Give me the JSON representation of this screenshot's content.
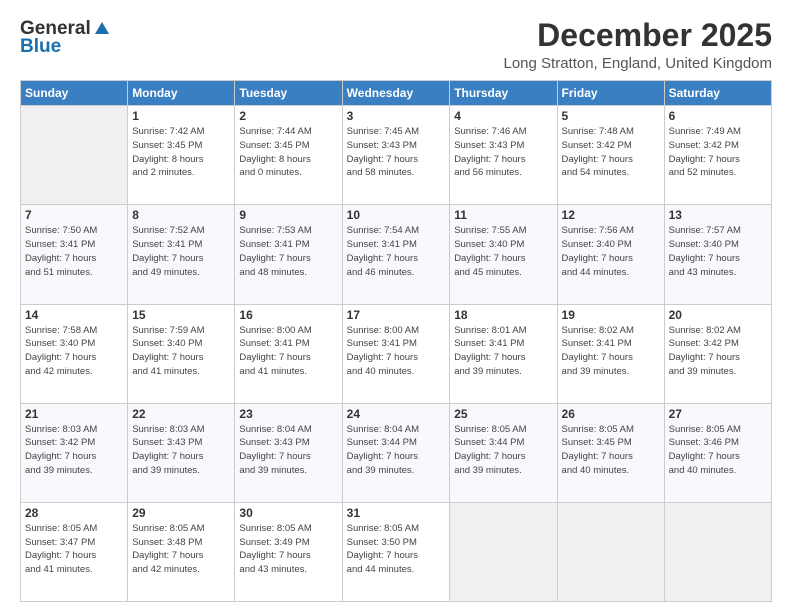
{
  "logo": {
    "general": "General",
    "blue": "Blue"
  },
  "header": {
    "month": "December 2025",
    "location": "Long Stratton, England, United Kingdom"
  },
  "weekdays": [
    "Sunday",
    "Monday",
    "Tuesday",
    "Wednesday",
    "Thursday",
    "Friday",
    "Saturday"
  ],
  "weeks": [
    [
      {
        "day": "",
        "info": ""
      },
      {
        "day": "1",
        "info": "Sunrise: 7:42 AM\nSunset: 3:45 PM\nDaylight: 8 hours\nand 2 minutes."
      },
      {
        "day": "2",
        "info": "Sunrise: 7:44 AM\nSunset: 3:45 PM\nDaylight: 8 hours\nand 0 minutes."
      },
      {
        "day": "3",
        "info": "Sunrise: 7:45 AM\nSunset: 3:43 PM\nDaylight: 7 hours\nand 58 minutes."
      },
      {
        "day": "4",
        "info": "Sunrise: 7:46 AM\nSunset: 3:43 PM\nDaylight: 7 hours\nand 56 minutes."
      },
      {
        "day": "5",
        "info": "Sunrise: 7:48 AM\nSunset: 3:42 PM\nDaylight: 7 hours\nand 54 minutes."
      },
      {
        "day": "6",
        "info": "Sunrise: 7:49 AM\nSunset: 3:42 PM\nDaylight: 7 hours\nand 52 minutes."
      }
    ],
    [
      {
        "day": "7",
        "info": "Sunrise: 7:50 AM\nSunset: 3:41 PM\nDaylight: 7 hours\nand 51 minutes."
      },
      {
        "day": "8",
        "info": "Sunrise: 7:52 AM\nSunset: 3:41 PM\nDaylight: 7 hours\nand 49 minutes."
      },
      {
        "day": "9",
        "info": "Sunrise: 7:53 AM\nSunset: 3:41 PM\nDaylight: 7 hours\nand 48 minutes."
      },
      {
        "day": "10",
        "info": "Sunrise: 7:54 AM\nSunset: 3:41 PM\nDaylight: 7 hours\nand 46 minutes."
      },
      {
        "day": "11",
        "info": "Sunrise: 7:55 AM\nSunset: 3:40 PM\nDaylight: 7 hours\nand 45 minutes."
      },
      {
        "day": "12",
        "info": "Sunrise: 7:56 AM\nSunset: 3:40 PM\nDaylight: 7 hours\nand 44 minutes."
      },
      {
        "day": "13",
        "info": "Sunrise: 7:57 AM\nSunset: 3:40 PM\nDaylight: 7 hours\nand 43 minutes."
      }
    ],
    [
      {
        "day": "14",
        "info": "Sunrise: 7:58 AM\nSunset: 3:40 PM\nDaylight: 7 hours\nand 42 minutes."
      },
      {
        "day": "15",
        "info": "Sunrise: 7:59 AM\nSunset: 3:40 PM\nDaylight: 7 hours\nand 41 minutes."
      },
      {
        "day": "16",
        "info": "Sunrise: 8:00 AM\nSunset: 3:41 PM\nDaylight: 7 hours\nand 41 minutes."
      },
      {
        "day": "17",
        "info": "Sunrise: 8:00 AM\nSunset: 3:41 PM\nDaylight: 7 hours\nand 40 minutes."
      },
      {
        "day": "18",
        "info": "Sunrise: 8:01 AM\nSunset: 3:41 PM\nDaylight: 7 hours\nand 39 minutes."
      },
      {
        "day": "19",
        "info": "Sunrise: 8:02 AM\nSunset: 3:41 PM\nDaylight: 7 hours\nand 39 minutes."
      },
      {
        "day": "20",
        "info": "Sunrise: 8:02 AM\nSunset: 3:42 PM\nDaylight: 7 hours\nand 39 minutes."
      }
    ],
    [
      {
        "day": "21",
        "info": "Sunrise: 8:03 AM\nSunset: 3:42 PM\nDaylight: 7 hours\nand 39 minutes."
      },
      {
        "day": "22",
        "info": "Sunrise: 8:03 AM\nSunset: 3:43 PM\nDaylight: 7 hours\nand 39 minutes."
      },
      {
        "day": "23",
        "info": "Sunrise: 8:04 AM\nSunset: 3:43 PM\nDaylight: 7 hours\nand 39 minutes."
      },
      {
        "day": "24",
        "info": "Sunrise: 8:04 AM\nSunset: 3:44 PM\nDaylight: 7 hours\nand 39 minutes."
      },
      {
        "day": "25",
        "info": "Sunrise: 8:05 AM\nSunset: 3:44 PM\nDaylight: 7 hours\nand 39 minutes."
      },
      {
        "day": "26",
        "info": "Sunrise: 8:05 AM\nSunset: 3:45 PM\nDaylight: 7 hours\nand 40 minutes."
      },
      {
        "day": "27",
        "info": "Sunrise: 8:05 AM\nSunset: 3:46 PM\nDaylight: 7 hours\nand 40 minutes."
      }
    ],
    [
      {
        "day": "28",
        "info": "Sunrise: 8:05 AM\nSunset: 3:47 PM\nDaylight: 7 hours\nand 41 minutes."
      },
      {
        "day": "29",
        "info": "Sunrise: 8:05 AM\nSunset: 3:48 PM\nDaylight: 7 hours\nand 42 minutes."
      },
      {
        "day": "30",
        "info": "Sunrise: 8:05 AM\nSunset: 3:49 PM\nDaylight: 7 hours\nand 43 minutes."
      },
      {
        "day": "31",
        "info": "Sunrise: 8:05 AM\nSunset: 3:50 PM\nDaylight: 7 hours\nand 44 minutes."
      },
      {
        "day": "",
        "info": ""
      },
      {
        "day": "",
        "info": ""
      },
      {
        "day": "",
        "info": ""
      }
    ]
  ]
}
